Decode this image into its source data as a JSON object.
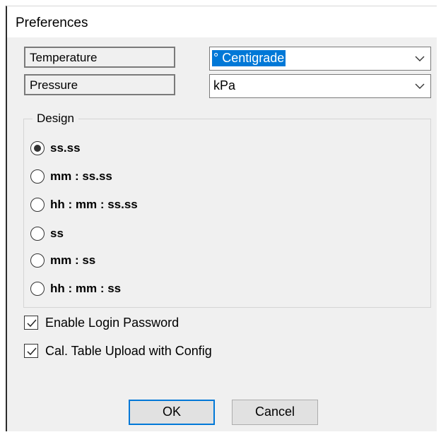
{
  "dialog": {
    "title": "Preferences"
  },
  "settings": {
    "temperature": {
      "label": "Temperature",
      "value": "° Centigrade"
    },
    "pressure": {
      "label": "Pressure",
      "value": "kPa"
    }
  },
  "design": {
    "legend": "Design",
    "options": [
      {
        "label": "ss.ss",
        "checked": true
      },
      {
        "label": "mm : ss.ss",
        "checked": false
      },
      {
        "label": "hh : mm : ss.ss",
        "checked": false
      },
      {
        "label": "ss",
        "checked": false
      },
      {
        "label": "mm : ss",
        "checked": false
      },
      {
        "label": "hh : mm : ss",
        "checked": false
      }
    ]
  },
  "checkboxes": [
    {
      "label": "Enable Login Password",
      "checked": true
    },
    {
      "label": "Cal. Table Upload with Config",
      "checked": true
    }
  ],
  "buttons": {
    "ok": "OK",
    "cancel": "Cancel"
  },
  "icons": {
    "combo_arrow": "chevron-down-icon",
    "check": "checkmark-icon"
  },
  "colors": {
    "accent": "#0078d7",
    "dialog_bg": "#f0f0f0"
  }
}
